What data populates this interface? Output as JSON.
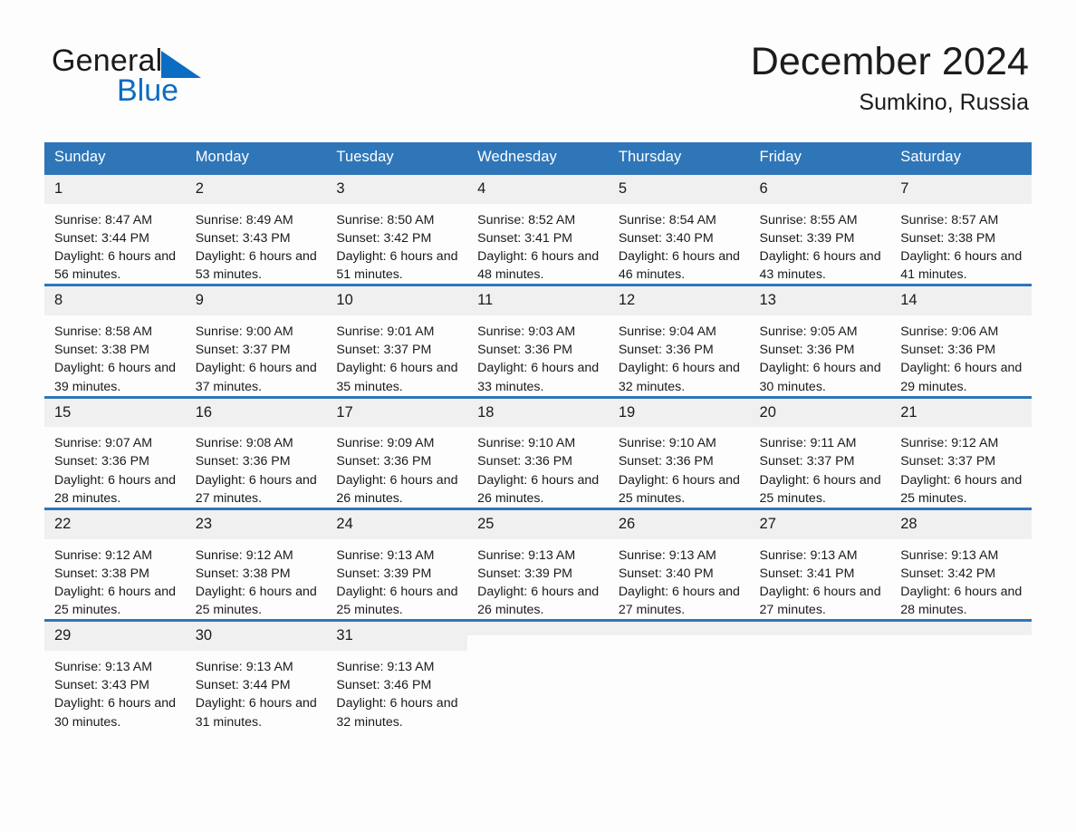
{
  "brand": {
    "name_part1": "General",
    "name_part2": "Blue",
    "logo_icon": "triangle-icon"
  },
  "header": {
    "month_title": "December 2024",
    "location": "Sumkino, Russia"
  },
  "colors": {
    "header_blue": "#2f76b8",
    "brand_blue": "#0b6cc4",
    "daynum_band": "#f0f0f0",
    "page_background": "#fdfdfd",
    "text": "#1a1a1a"
  },
  "calendar": {
    "weekday_headers": [
      "Sunday",
      "Monday",
      "Tuesday",
      "Wednesday",
      "Thursday",
      "Friday",
      "Saturday"
    ],
    "weeks": [
      [
        {
          "day": "1",
          "sunrise": "Sunrise: 8:47 AM",
          "sunset": "Sunset: 3:44 PM",
          "daylight": "Daylight: 6 hours and 56 minutes."
        },
        {
          "day": "2",
          "sunrise": "Sunrise: 8:49 AM",
          "sunset": "Sunset: 3:43 PM",
          "daylight": "Daylight: 6 hours and 53 minutes."
        },
        {
          "day": "3",
          "sunrise": "Sunrise: 8:50 AM",
          "sunset": "Sunset: 3:42 PM",
          "daylight": "Daylight: 6 hours and 51 minutes."
        },
        {
          "day": "4",
          "sunrise": "Sunrise: 8:52 AM",
          "sunset": "Sunset: 3:41 PM",
          "daylight": "Daylight: 6 hours and 48 minutes."
        },
        {
          "day": "5",
          "sunrise": "Sunrise: 8:54 AM",
          "sunset": "Sunset: 3:40 PM",
          "daylight": "Daylight: 6 hours and 46 minutes."
        },
        {
          "day": "6",
          "sunrise": "Sunrise: 8:55 AM",
          "sunset": "Sunset: 3:39 PM",
          "daylight": "Daylight: 6 hours and 43 minutes."
        },
        {
          "day": "7",
          "sunrise": "Sunrise: 8:57 AM",
          "sunset": "Sunset: 3:38 PM",
          "daylight": "Daylight: 6 hours and 41 minutes."
        }
      ],
      [
        {
          "day": "8",
          "sunrise": "Sunrise: 8:58 AM",
          "sunset": "Sunset: 3:38 PM",
          "daylight": "Daylight: 6 hours and 39 minutes."
        },
        {
          "day": "9",
          "sunrise": "Sunrise: 9:00 AM",
          "sunset": "Sunset: 3:37 PM",
          "daylight": "Daylight: 6 hours and 37 minutes."
        },
        {
          "day": "10",
          "sunrise": "Sunrise: 9:01 AM",
          "sunset": "Sunset: 3:37 PM",
          "daylight": "Daylight: 6 hours and 35 minutes."
        },
        {
          "day": "11",
          "sunrise": "Sunrise: 9:03 AM",
          "sunset": "Sunset: 3:36 PM",
          "daylight": "Daylight: 6 hours and 33 minutes."
        },
        {
          "day": "12",
          "sunrise": "Sunrise: 9:04 AM",
          "sunset": "Sunset: 3:36 PM",
          "daylight": "Daylight: 6 hours and 32 minutes."
        },
        {
          "day": "13",
          "sunrise": "Sunrise: 9:05 AM",
          "sunset": "Sunset: 3:36 PM",
          "daylight": "Daylight: 6 hours and 30 minutes."
        },
        {
          "day": "14",
          "sunrise": "Sunrise: 9:06 AM",
          "sunset": "Sunset: 3:36 PM",
          "daylight": "Daylight: 6 hours and 29 minutes."
        }
      ],
      [
        {
          "day": "15",
          "sunrise": "Sunrise: 9:07 AM",
          "sunset": "Sunset: 3:36 PM",
          "daylight": "Daylight: 6 hours and 28 minutes."
        },
        {
          "day": "16",
          "sunrise": "Sunrise: 9:08 AM",
          "sunset": "Sunset: 3:36 PM",
          "daylight": "Daylight: 6 hours and 27 minutes."
        },
        {
          "day": "17",
          "sunrise": "Sunrise: 9:09 AM",
          "sunset": "Sunset: 3:36 PM",
          "daylight": "Daylight: 6 hours and 26 minutes."
        },
        {
          "day": "18",
          "sunrise": "Sunrise: 9:10 AM",
          "sunset": "Sunset: 3:36 PM",
          "daylight": "Daylight: 6 hours and 26 minutes."
        },
        {
          "day": "19",
          "sunrise": "Sunrise: 9:10 AM",
          "sunset": "Sunset: 3:36 PM",
          "daylight": "Daylight: 6 hours and 25 minutes."
        },
        {
          "day": "20",
          "sunrise": "Sunrise: 9:11 AM",
          "sunset": "Sunset: 3:37 PM",
          "daylight": "Daylight: 6 hours and 25 minutes."
        },
        {
          "day": "21",
          "sunrise": "Sunrise: 9:12 AM",
          "sunset": "Sunset: 3:37 PM",
          "daylight": "Daylight: 6 hours and 25 minutes."
        }
      ],
      [
        {
          "day": "22",
          "sunrise": "Sunrise: 9:12 AM",
          "sunset": "Sunset: 3:38 PM",
          "daylight": "Daylight: 6 hours and 25 minutes."
        },
        {
          "day": "23",
          "sunrise": "Sunrise: 9:12 AM",
          "sunset": "Sunset: 3:38 PM",
          "daylight": "Daylight: 6 hours and 25 minutes."
        },
        {
          "day": "24",
          "sunrise": "Sunrise: 9:13 AM",
          "sunset": "Sunset: 3:39 PM",
          "daylight": "Daylight: 6 hours and 25 minutes."
        },
        {
          "day": "25",
          "sunrise": "Sunrise: 9:13 AM",
          "sunset": "Sunset: 3:39 PM",
          "daylight": "Daylight: 6 hours and 26 minutes."
        },
        {
          "day": "26",
          "sunrise": "Sunrise: 9:13 AM",
          "sunset": "Sunset: 3:40 PM",
          "daylight": "Daylight: 6 hours and 27 minutes."
        },
        {
          "day": "27",
          "sunrise": "Sunrise: 9:13 AM",
          "sunset": "Sunset: 3:41 PM",
          "daylight": "Daylight: 6 hours and 27 minutes."
        },
        {
          "day": "28",
          "sunrise": "Sunrise: 9:13 AM",
          "sunset": "Sunset: 3:42 PM",
          "daylight": "Daylight: 6 hours and 28 minutes."
        }
      ],
      [
        {
          "day": "29",
          "sunrise": "Sunrise: 9:13 AM",
          "sunset": "Sunset: 3:43 PM",
          "daylight": "Daylight: 6 hours and 30 minutes."
        },
        {
          "day": "30",
          "sunrise": "Sunrise: 9:13 AM",
          "sunset": "Sunset: 3:44 PM",
          "daylight": "Daylight: 6 hours and 31 minutes."
        },
        {
          "day": "31",
          "sunrise": "Sunrise: 9:13 AM",
          "sunset": "Sunset: 3:46 PM",
          "daylight": "Daylight: 6 hours and 32 minutes."
        },
        {
          "day": "",
          "sunrise": "",
          "sunset": "",
          "daylight": ""
        },
        {
          "day": "",
          "sunrise": "",
          "sunset": "",
          "daylight": ""
        },
        {
          "day": "",
          "sunrise": "",
          "sunset": "",
          "daylight": ""
        },
        {
          "day": "",
          "sunrise": "",
          "sunset": "",
          "daylight": ""
        }
      ]
    ]
  }
}
